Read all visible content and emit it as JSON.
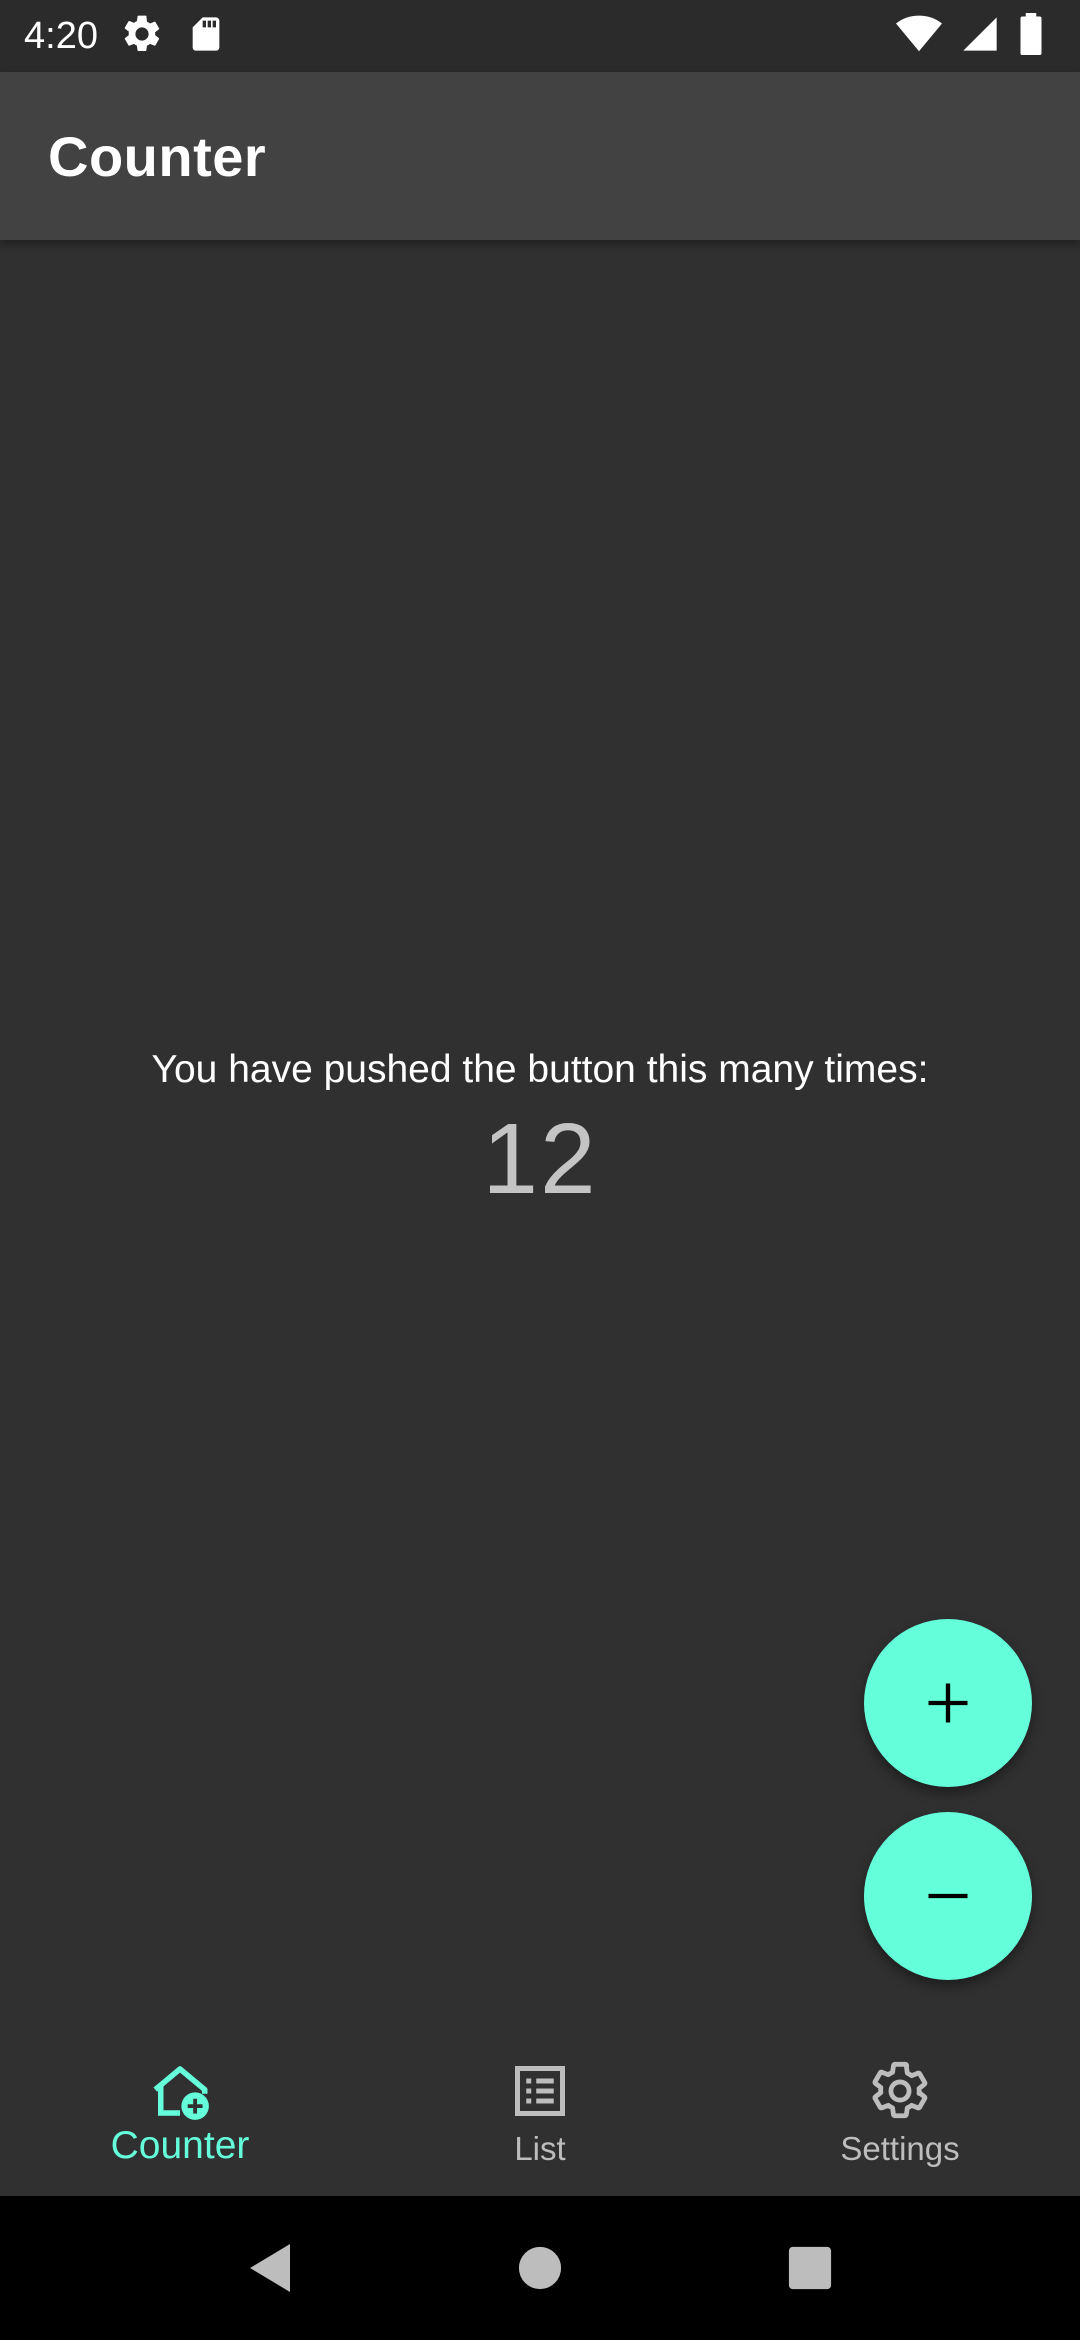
{
  "status_bar": {
    "time": "4:20",
    "icons": [
      "settings-gear-icon",
      "sd-card-icon",
      "wifi-icon",
      "cell-signal-icon",
      "battery-icon"
    ]
  },
  "app_bar": {
    "title": "Counter"
  },
  "main": {
    "counter_label": "You have pushed the button this many times:",
    "counter_value": "12"
  },
  "fabs": {
    "increment_icon": "plus-icon",
    "decrement_icon": "minus-icon"
  },
  "bottom_nav": {
    "items": [
      {
        "label": "Counter",
        "icon": "home-add-icon",
        "active": true
      },
      {
        "label": "List",
        "icon": "list-icon",
        "active": false
      },
      {
        "label": "Settings",
        "icon": "settings-icon",
        "active": false
      }
    ]
  },
  "system_nav": {
    "buttons": [
      "back-icon",
      "home-icon",
      "recents-icon"
    ]
  },
  "colors": {
    "accent": "#64ffda",
    "background": "#303030",
    "app_bar": "#424242",
    "status_bar": "#2b2b2b",
    "system_nav": "#000000"
  }
}
